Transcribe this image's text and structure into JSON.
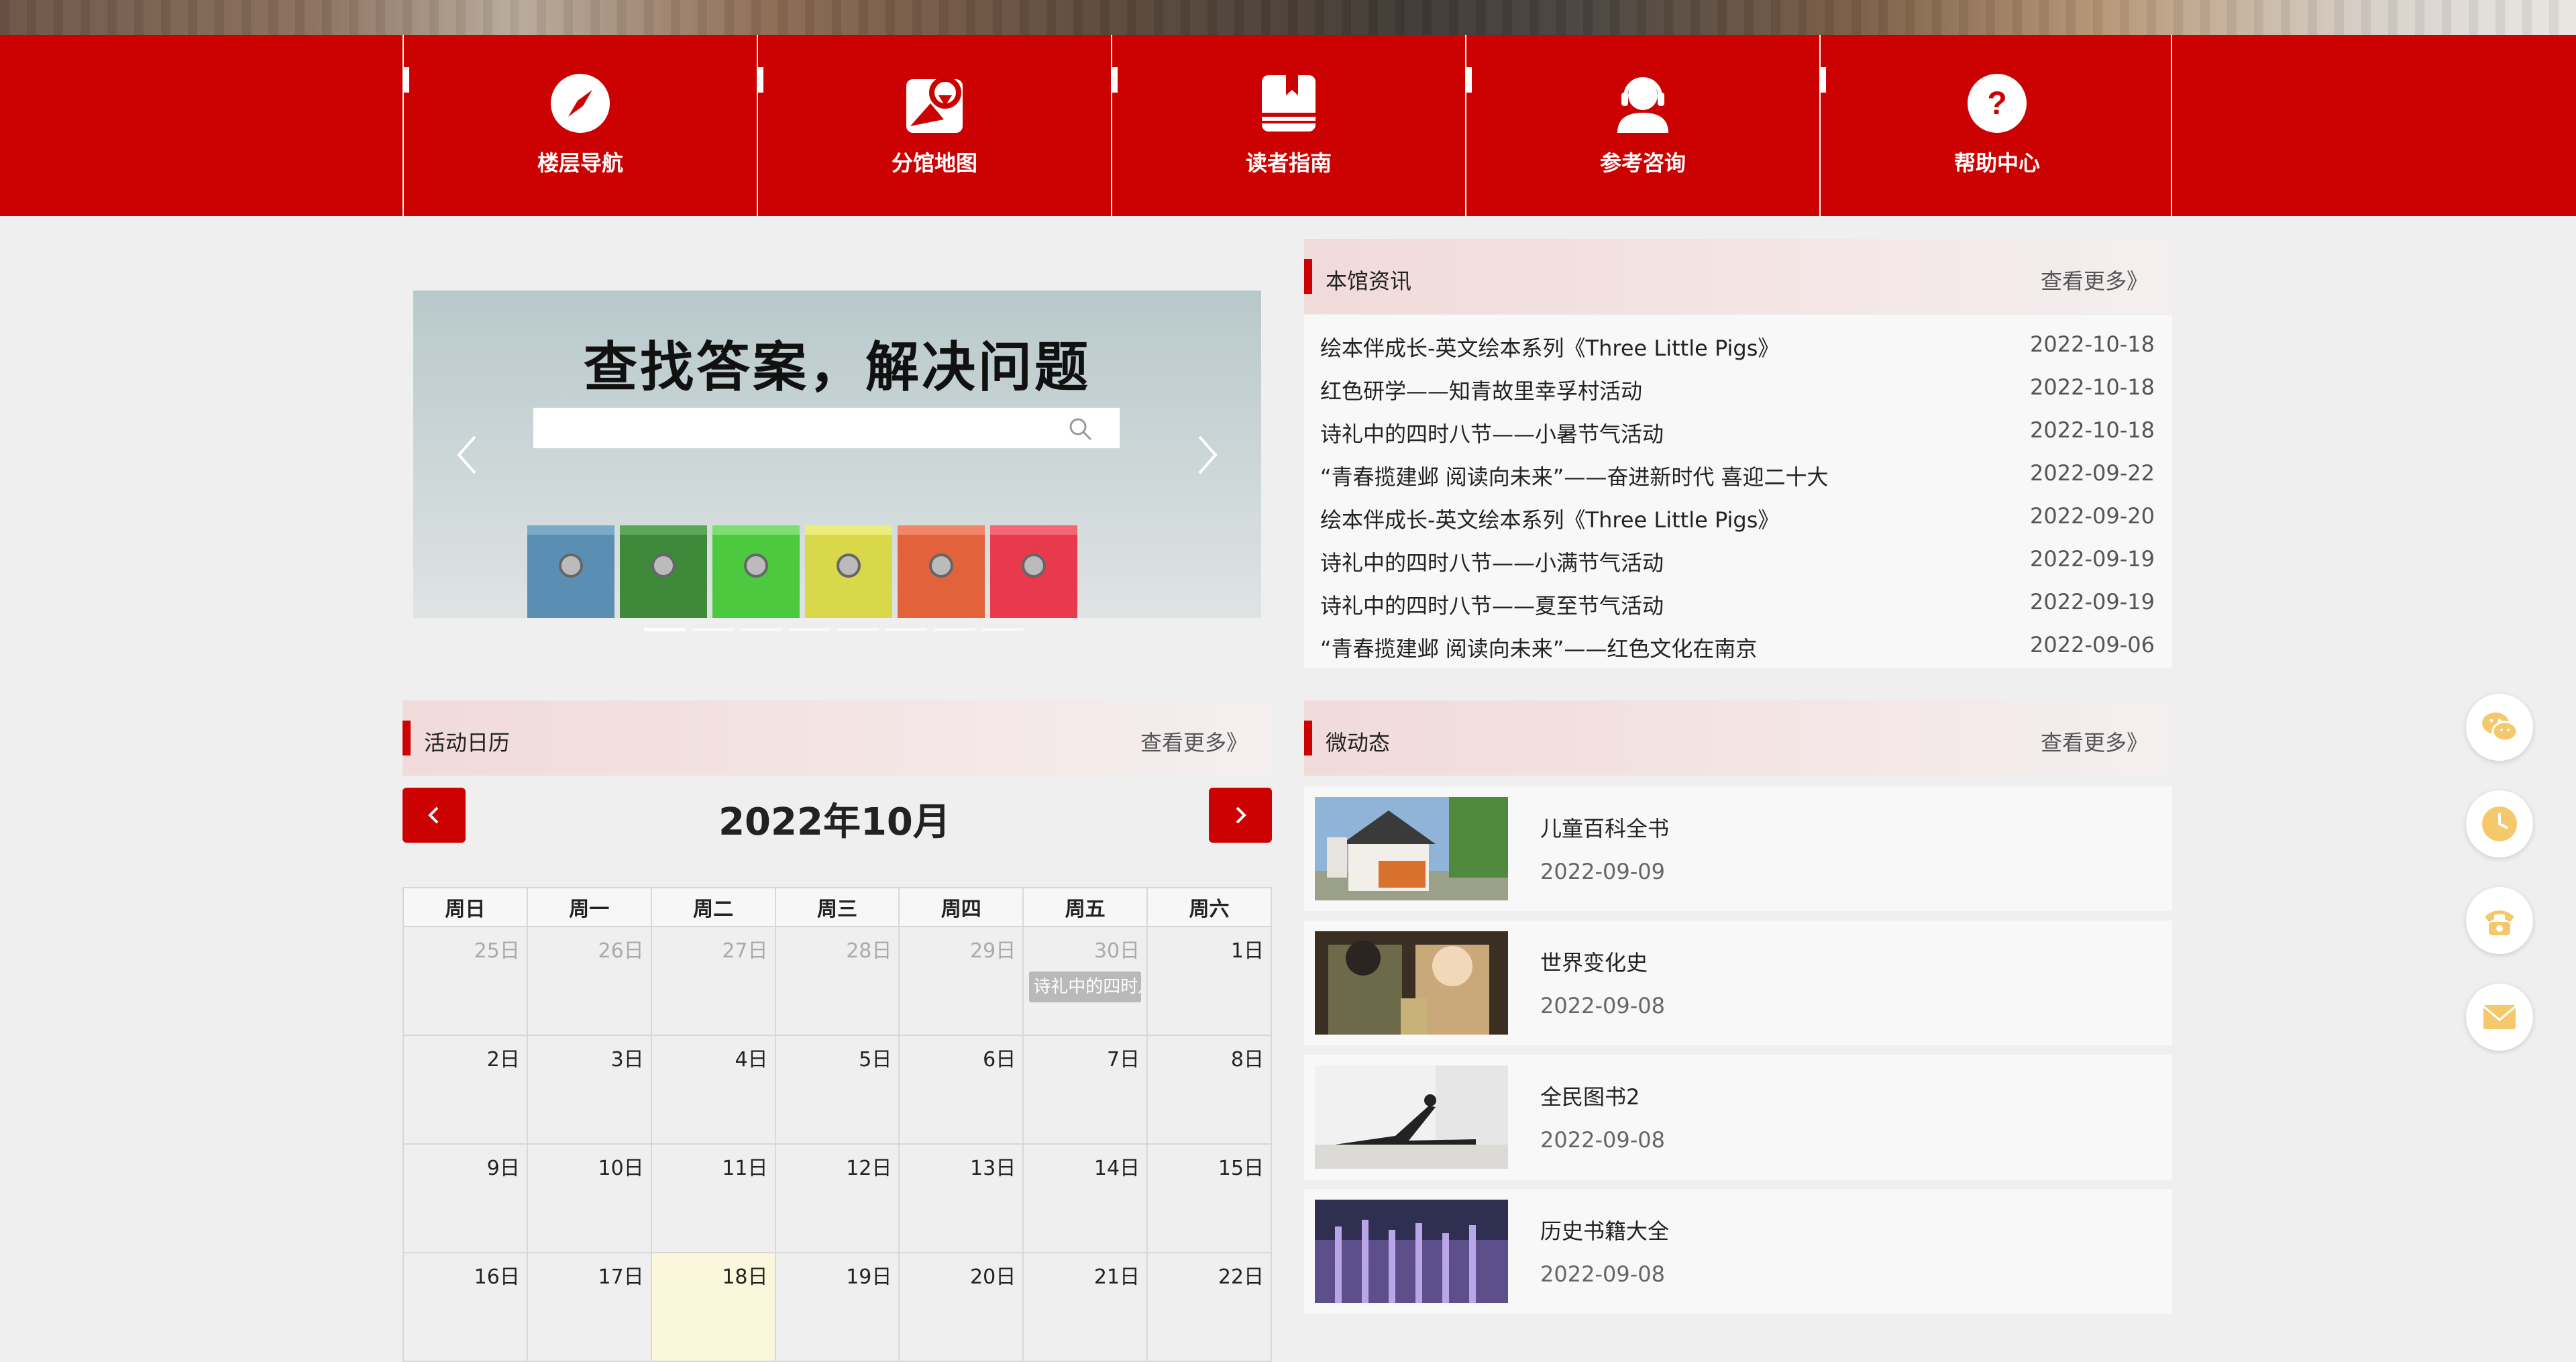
{
  "nav": {
    "items": [
      {
        "label": "楼层导航",
        "icon": "compass-icon"
      },
      {
        "label": "分馆地图",
        "icon": "map-pin-icon"
      },
      {
        "label": "读者指南",
        "icon": "book-icon"
      },
      {
        "label": "参考咨询",
        "icon": "headset-icon"
      },
      {
        "label": "帮助中心",
        "icon": "question-icon"
      }
    ]
  },
  "banner": {
    "title": "查找答案，解决问题",
    "search_placeholder": "",
    "slide_count": 8,
    "active_slide": 1
  },
  "news": {
    "title": "本馆资讯",
    "more": "查看更多》",
    "items": [
      {
        "title": "绘本伴成长-英文绘本系列《Three Little Pigs》",
        "date": "2022-10-18"
      },
      {
        "title": "红色研学——知青故里幸孚村活动",
        "date": "2022-10-18"
      },
      {
        "title": "诗礼中的四时八节——小暑节气活动",
        "date": "2022-10-18"
      },
      {
        "title": "“青春揽建邺 阅读向未来”——奋进新时代 喜迎二十大",
        "date": "2022-09-22"
      },
      {
        "title": "绘本伴成长-英文绘本系列《Three Little Pigs》",
        "date": "2022-09-20"
      },
      {
        "title": "诗礼中的四时八节——小满节气活动",
        "date": "2022-09-19"
      },
      {
        "title": "诗礼中的四时八节——夏至节气活动",
        "date": "2022-09-19"
      },
      {
        "title": "“青春揽建邺 阅读向未来”——红色文化在南京",
        "date": "2022-09-06"
      }
    ]
  },
  "calendar": {
    "title": "活动日历",
    "more": "查看更多》",
    "month": "2022年10月",
    "weekdays": [
      "周日",
      "周一",
      "周二",
      "周三",
      "周四",
      "周五",
      "周六"
    ],
    "rows": [
      [
        "25日",
        "26日",
        "27日",
        "28日",
        "29日",
        "30日",
        "1日"
      ],
      [
        "2日",
        "3日",
        "4日",
        "5日",
        "6日",
        "7日",
        "8日"
      ],
      [
        "9日",
        "10日",
        "11日",
        "12日",
        "13日",
        "14日",
        "15日"
      ],
      [
        "16日",
        "17日",
        "18日",
        "19日",
        "20日",
        "21日",
        "22日"
      ]
    ],
    "event": "诗礼中的四时八节"
  },
  "micro": {
    "title": "微动态",
    "more": "查看更多》",
    "items": [
      {
        "title": "儿童百科全书",
        "date": "2022-09-09"
      },
      {
        "title": "世界变化史",
        "date": "2022-09-08"
      },
      {
        "title": "全民图书2",
        "date": "2022-09-08"
      },
      {
        "title": "历史书籍大全",
        "date": "2022-09-08"
      }
    ]
  },
  "floating": [
    "wechat-icon",
    "clock-icon",
    "phone-icon",
    "mail-icon"
  ],
  "colors": {
    "accent": "#cc0202",
    "background": "#efefef",
    "float_icon": "#f5c96b"
  }
}
